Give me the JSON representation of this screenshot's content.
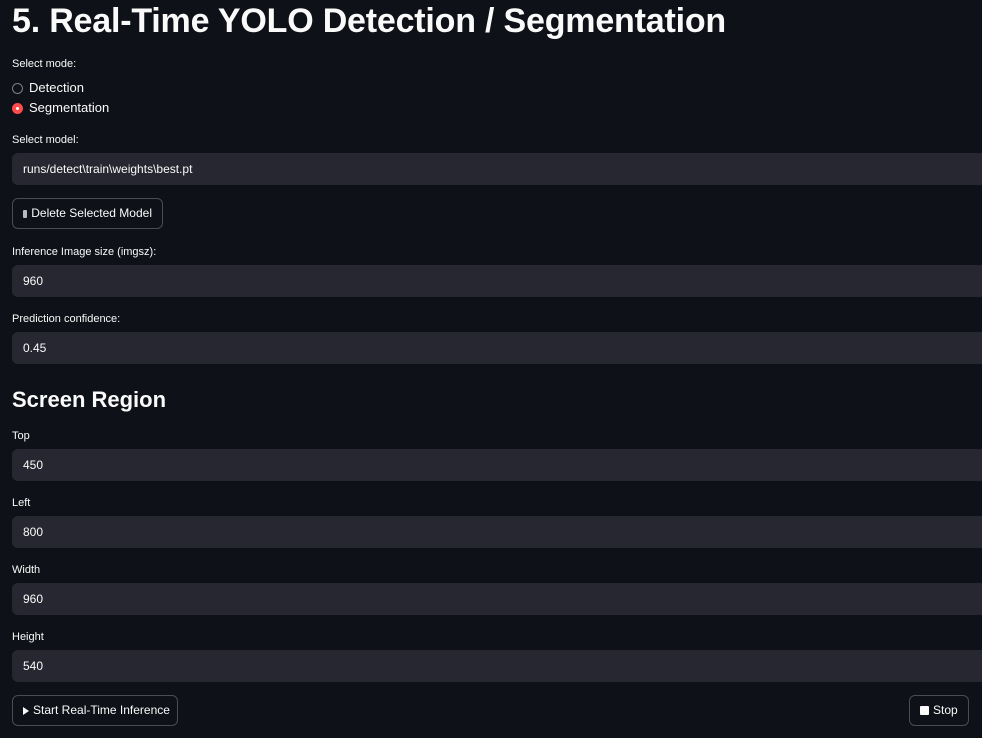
{
  "page_title": "5. Real-Time YOLO Detection / Segmentation",
  "mode": {
    "label": "Select mode:",
    "options": [
      "Detection",
      "Segmentation"
    ],
    "selected": "Segmentation"
  },
  "model": {
    "label": "Select model:",
    "value": "runs/detect\\train\\weights\\best.pt",
    "delete_label": "Delete Selected Model",
    "delete_icon": "trash-icon"
  },
  "imgsz": {
    "label": "Inference Image size (imgsz):",
    "value": "960"
  },
  "confidence": {
    "label": "Prediction confidence:",
    "value": "0.45"
  },
  "screen_region": {
    "heading": "Screen Region",
    "top": {
      "label": "Top",
      "value": "450"
    },
    "left": {
      "label": "Left",
      "value": "800"
    },
    "width": {
      "label": "Width",
      "value": "960"
    },
    "height": {
      "label": "Height",
      "value": "540"
    }
  },
  "actions": {
    "start_label": "Start Real-Time Inference",
    "start_icon": "play-icon",
    "stop_label": "Stop",
    "stop_icon": "stop-icon"
  },
  "colors": {
    "background": "#0e1117",
    "input_bg": "#262730",
    "accent": "#ff4b4b",
    "text": "#fafafa"
  }
}
